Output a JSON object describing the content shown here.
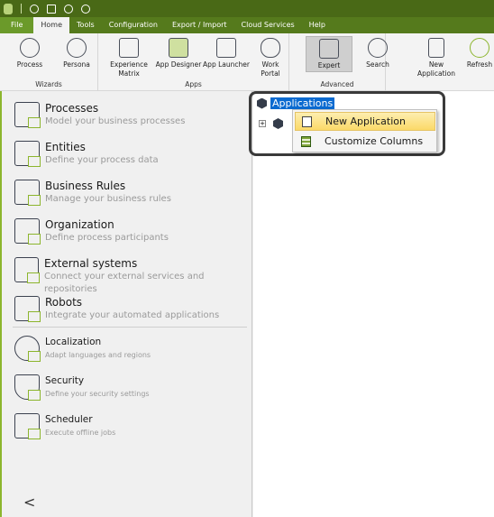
{
  "quick_access": {
    "icons": [
      "app-logo",
      "process-wizard-icon",
      "layout-icon",
      "user-icon",
      "user-icon"
    ]
  },
  "tabs": [
    {
      "label": "File"
    },
    {
      "label": "Home",
      "active": true
    },
    {
      "label": "Tools"
    },
    {
      "label": "Configuration"
    },
    {
      "label": "Export / Import"
    },
    {
      "label": "Cloud Services"
    },
    {
      "label": "Help"
    }
  ],
  "ribbon": {
    "groups": [
      {
        "label": "Wizards",
        "buttons": [
          {
            "label": "Process"
          },
          {
            "label": "Persona"
          }
        ]
      },
      {
        "label": "Apps",
        "buttons": [
          {
            "label": "Experience Matrix"
          },
          {
            "label": "App Designer"
          },
          {
            "label": "App Launcher"
          },
          {
            "label": "Work Portal"
          }
        ]
      },
      {
        "label": "Advanced",
        "buttons": [
          {
            "label": "Expert",
            "selected": true
          },
          {
            "label": "Search"
          }
        ]
      },
      {
        "label": "",
        "buttons": [
          {
            "label": "New Application"
          },
          {
            "label": "Refresh"
          }
        ]
      }
    ]
  },
  "sidebar": {
    "items": [
      {
        "title": "Processes",
        "desc": "Model your business processes"
      },
      {
        "title": "Entities",
        "desc": "Define your process data"
      },
      {
        "title": "Business  Rules",
        "desc": "Manage your business rules"
      },
      {
        "title": "Organization",
        "desc": "Define process participants"
      },
      {
        "title": "External systems",
        "desc": "Connect your external services and repositories"
      },
      {
        "title": "Robots",
        "desc": "Integrate your automated applications"
      },
      {
        "title": "Localization",
        "desc": "Adapt languages and regions"
      },
      {
        "title": "Security",
        "desc": "Define your security settings"
      },
      {
        "title": "Scheduler",
        "desc": "Execute offline jobs"
      }
    ],
    "collapse": "<"
  },
  "tree": {
    "root": "Applications",
    "expander": "+"
  },
  "context_menu": {
    "items": [
      {
        "label": "New Application",
        "highlighted": true
      },
      {
        "label": "Customize Columns"
      }
    ]
  },
  "colors": {
    "accent": "#8cb52d",
    "titlebar": "#496916",
    "selection": "#0a6ad0"
  }
}
